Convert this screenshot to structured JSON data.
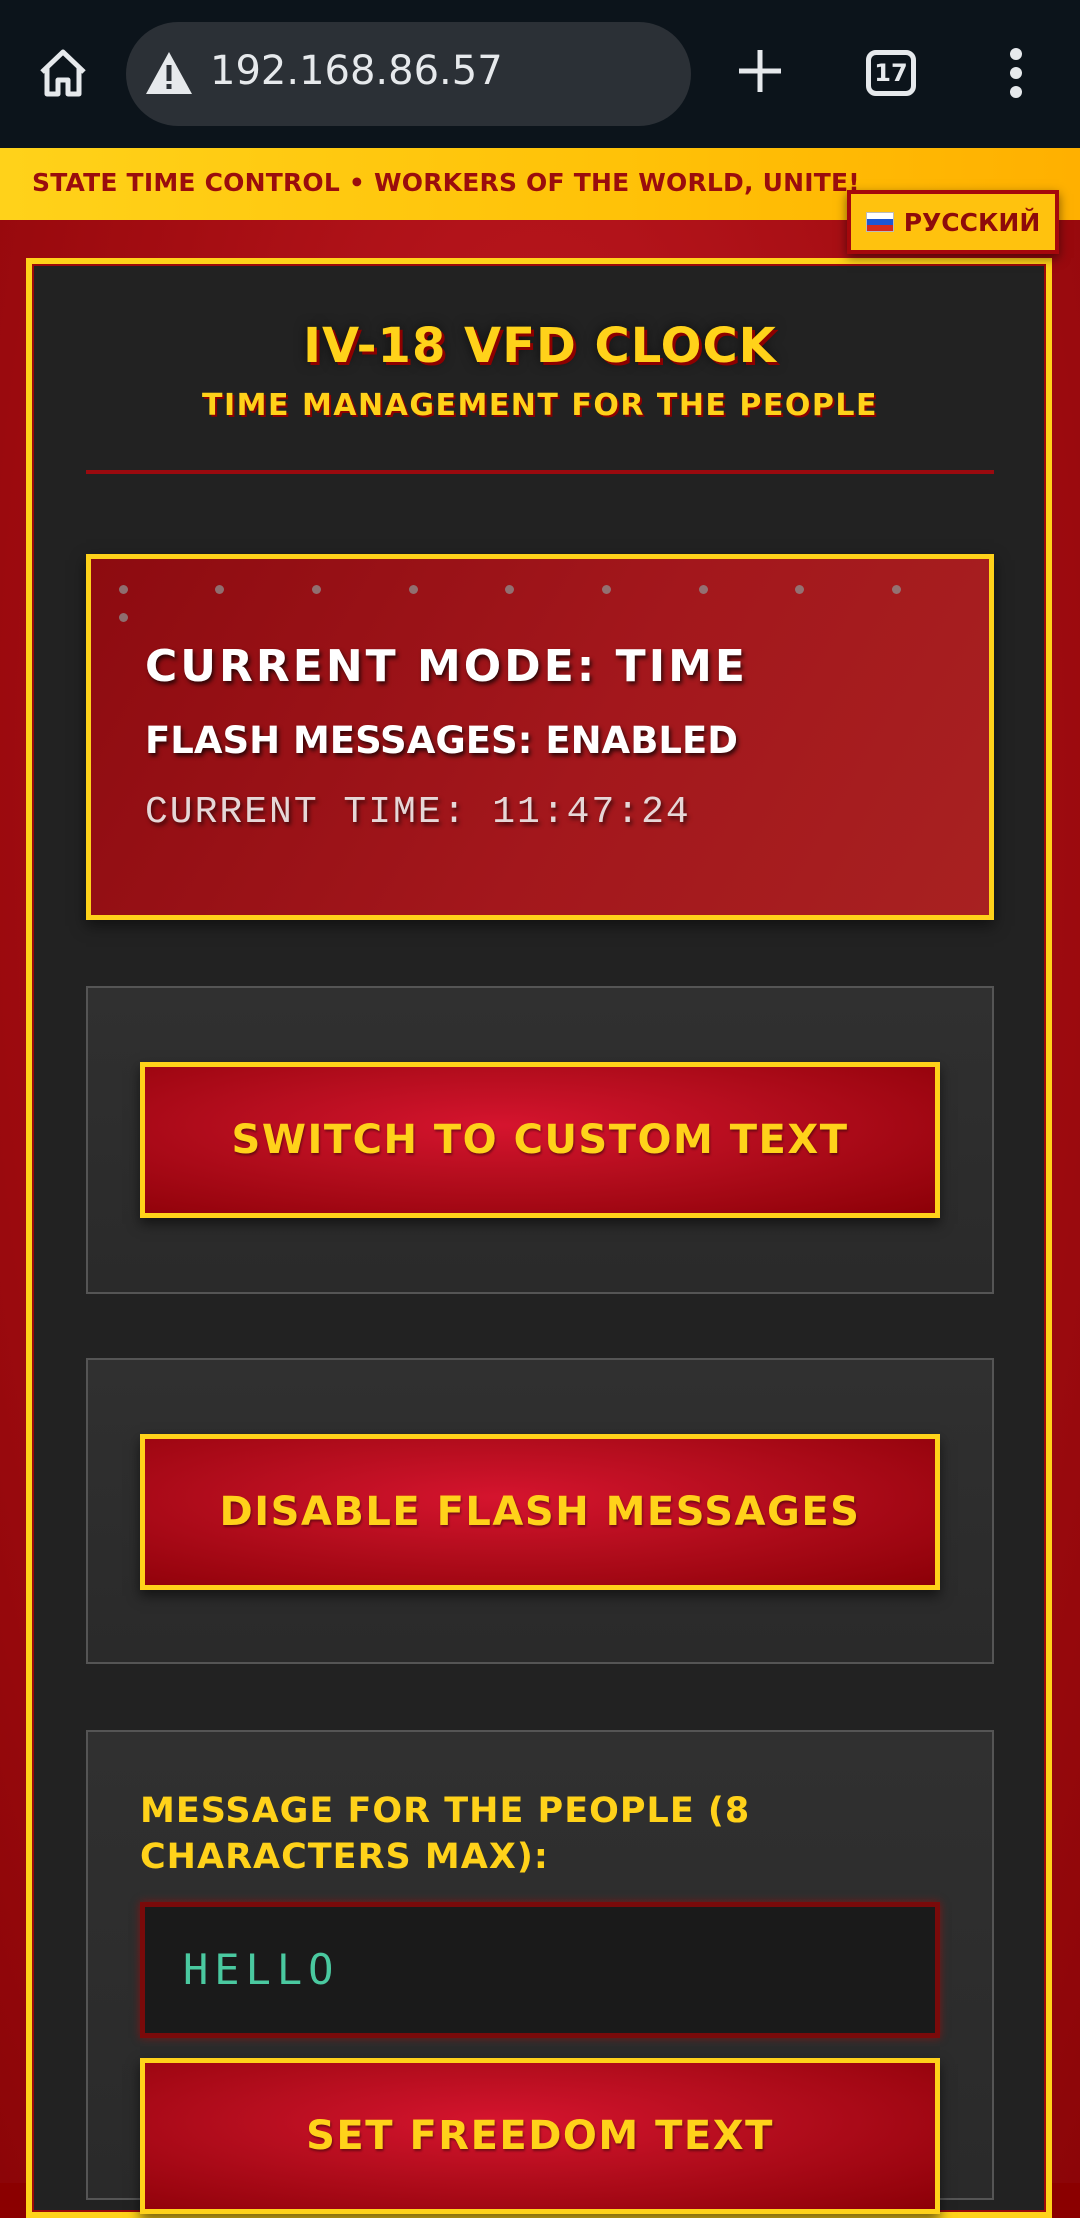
{
  "browser": {
    "url": "192.168.86.57",
    "tab_count": "17"
  },
  "banner": {
    "slogan": "STATE TIME CONTROL • WORKERS OF THE WORLD, UNITE!",
    "language_button": "РУССКИЙ"
  },
  "header": {
    "title": "IV-18 VFD CLOCK",
    "subtitle": "TIME MANAGEMENT FOR THE PEOPLE"
  },
  "status": {
    "mode": "CURRENT MODE: TIME",
    "flash": "FLASH MESSAGES: ENABLED",
    "time": "CURRENT TIME: 11:47:24"
  },
  "controls": {
    "switch_mode_label": "SWITCH TO CUSTOM TEXT",
    "flash_toggle_label": "DISABLE FLASH MESSAGES",
    "message_label": "MESSAGE FOR THE PEOPLE (8 CHARACTERS MAX):",
    "message_value": "HELLO",
    "set_text_label": "SET FREEDOM TEXT"
  },
  "colors": {
    "accent_yellow": "#ffd21a",
    "primary_red": "#b30d1d",
    "panel_dark": "#222222",
    "input_text": "#4ac9a0"
  }
}
